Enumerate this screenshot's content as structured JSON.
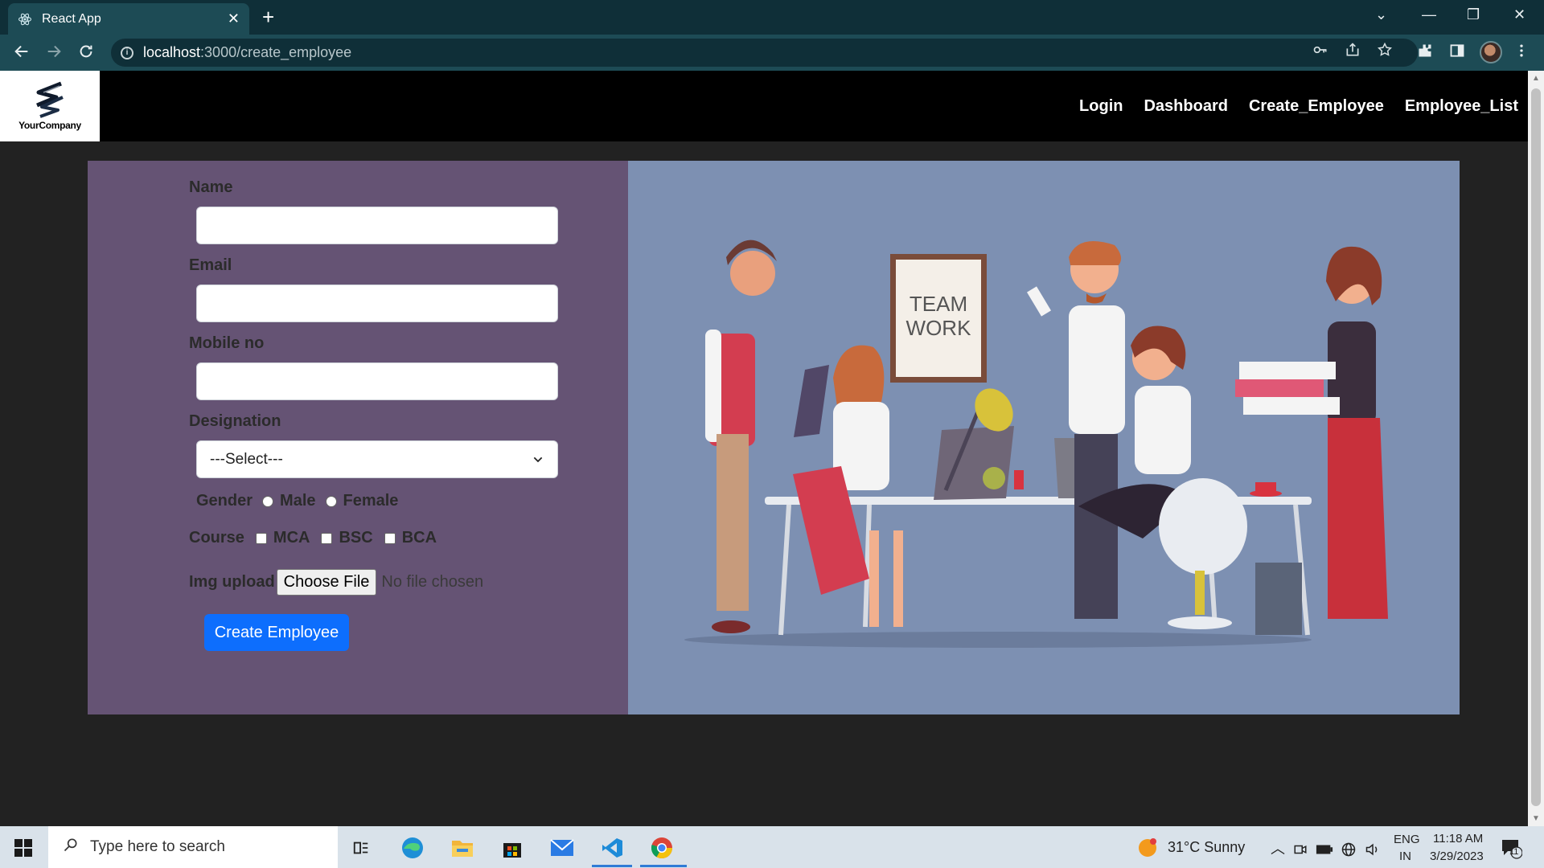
{
  "browser": {
    "tab_title": "React App",
    "tab_close": "✕",
    "new_tab": "+",
    "url_host": "localhost",
    "url_path": ":3000/create_employee",
    "window_controls": {
      "dropdown": "⌄",
      "minimize": "—",
      "restore": "❐",
      "close": "✕"
    }
  },
  "navbar": {
    "logo_text": "YourCompany",
    "links": [
      "Login",
      "Dashboard",
      "Create_Employee",
      "Employee_List"
    ]
  },
  "form": {
    "name_label": "Name",
    "email_label": "Email",
    "mobile_label": "Mobile no",
    "designation_label": "Designation",
    "designation_selected": "---Select---",
    "gender_label": "Gender",
    "gender_options": [
      "Male",
      "Female"
    ],
    "course_label": "Course",
    "course_options": [
      "MCA",
      "BSC",
      "BCA"
    ],
    "img_label": "Img upload",
    "file_button": "Choose File",
    "file_status": "No file chosen",
    "submit_label": "Create Employee"
  },
  "illustration": {
    "poster_line1": "TEAM",
    "poster_line2": "WORK"
  },
  "taskbar": {
    "search_placeholder": "Type here to search",
    "weather": "31°C  Sunny",
    "lang_line1": "ENG",
    "lang_line2": "IN",
    "time": "11:18 AM",
    "date": "3/29/2023",
    "notification_count": "11"
  },
  "colors": {
    "form_bg": "#655374",
    "image_bg": "#7d90b2",
    "primary": "#0d6efd",
    "page_bg": "#222222",
    "chrome": "#1d4b55"
  }
}
